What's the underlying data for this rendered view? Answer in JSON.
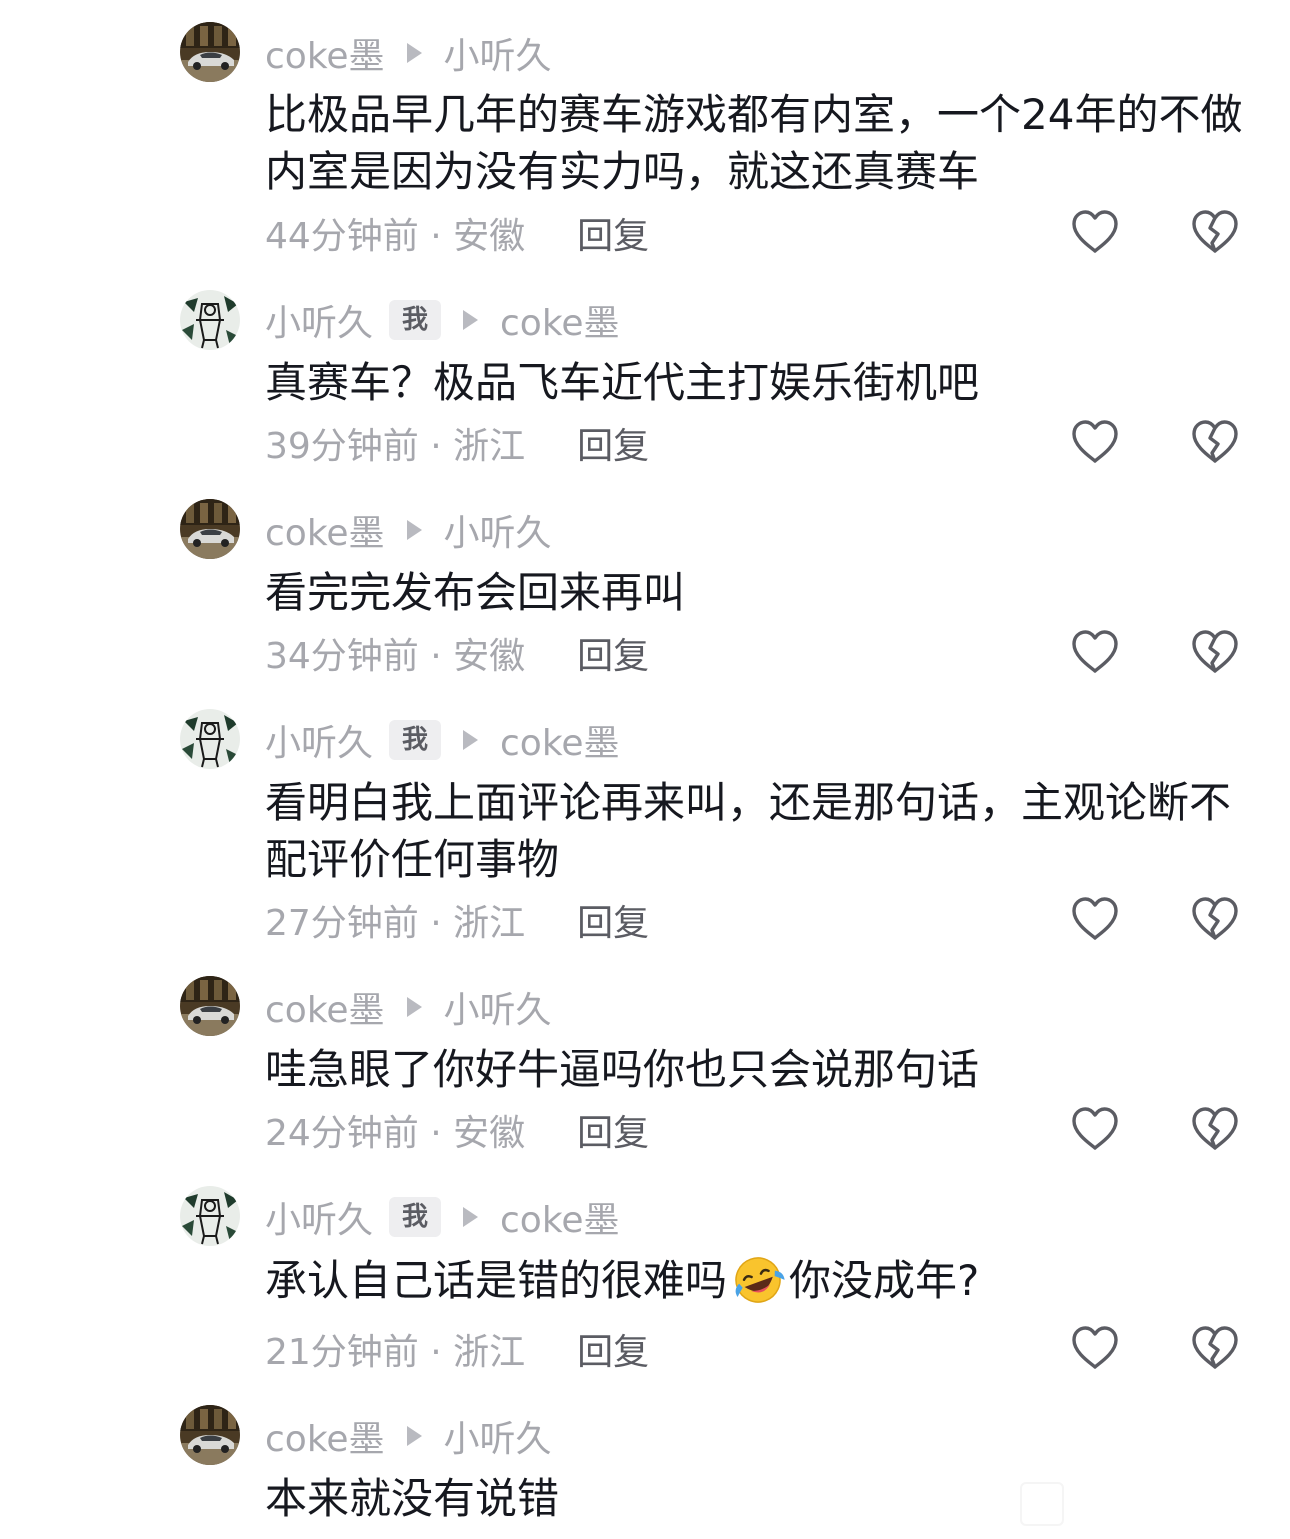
{
  "comments": [
    {
      "author": "coke墨",
      "is_me": false,
      "reply_to": "小听久",
      "text": "比极品早几年的赛车游戏都有内室，一个24年的不做内室是因为没有实力吗，就这还真赛车",
      "time_location": "44分钟前 · 安徽",
      "reply_label": "回复",
      "avatar": "car-avatar"
    },
    {
      "author": "小听久",
      "is_me": true,
      "me_badge": "我",
      "reply_to": "coke墨",
      "text": "真赛车？极品飞车近代主打娱乐街机吧",
      "time_location": "39分钟前 · 浙江",
      "reply_label": "回复",
      "avatar": "sketch-avatar"
    },
    {
      "author": "coke墨",
      "is_me": false,
      "reply_to": "小听久",
      "text": "看完完发布会回来再叫",
      "time_location": "34分钟前 · 安徽",
      "reply_label": "回复",
      "avatar": "car-avatar"
    },
    {
      "author": "小听久",
      "is_me": true,
      "me_badge": "我",
      "reply_to": "coke墨",
      "text": "看明白我上面评论再来叫，还是那句话，主观论断不配评价任何事物",
      "time_location": "27分钟前 · 浙江",
      "reply_label": "回复",
      "avatar": "sketch-avatar"
    },
    {
      "author": "coke墨",
      "is_me": false,
      "reply_to": "小听久",
      "text": "哇急眼了你好牛逼吗你也只会说那句话",
      "time_location": "24分钟前 · 安徽",
      "reply_label": "回复",
      "avatar": "car-avatar"
    },
    {
      "author": "小听久",
      "is_me": true,
      "me_badge": "我",
      "reply_to": "coke墨",
      "text_before_emoji": "承认自己话是错的很难吗",
      "emoji": "rolling-on-floor-laughing-emoji",
      "text_after_emoji": "你没成年?",
      "time_location": "21分钟前 · 浙江",
      "reply_label": "回复",
      "avatar": "sketch-avatar"
    },
    {
      "author": "coke墨",
      "is_me": false,
      "reply_to": "小听久",
      "text": "本来就没有说错",
      "avatar": "car-avatar"
    }
  ],
  "icons": {
    "like": "heart-outline-icon",
    "dislike": "broken-heart-icon",
    "reply_arrow": "play-arrow-icon"
  },
  "colors": {
    "meta_gray": "#a6a7ad",
    "text": "#16181f",
    "reply_label": "#5b5c63",
    "badge_bg": "#eeeef0"
  }
}
